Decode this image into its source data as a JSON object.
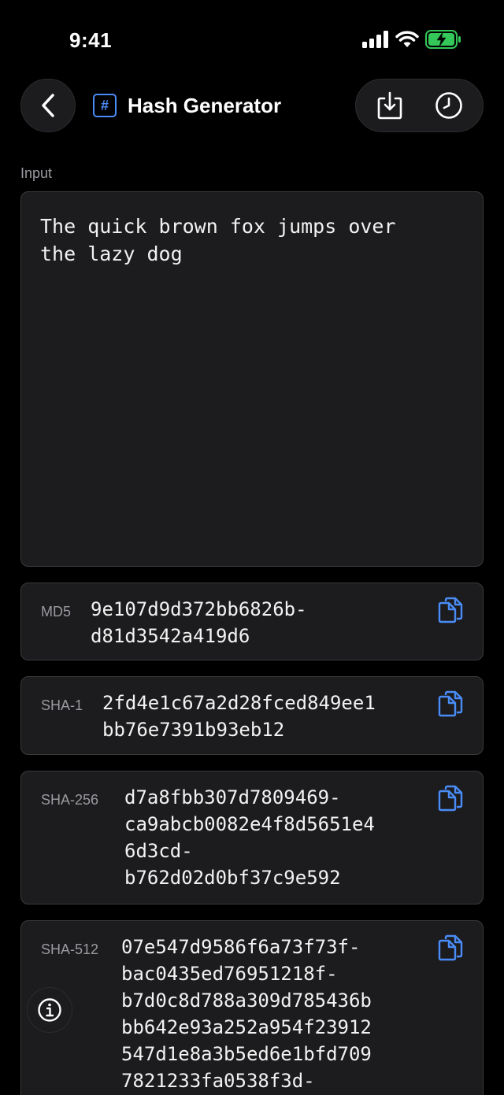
{
  "status_bar": {
    "time": "9:41"
  },
  "header": {
    "title": "Hash Generator",
    "title_icon": "hash-icon",
    "title_icon_glyph": "#"
  },
  "input": {
    "label": "Input",
    "value": "The quick brown fox jumps over\nthe lazy dog"
  },
  "hashes": [
    {
      "label": "MD5",
      "value": "9e107d9d372bb6826b-\nd81d3542a419d6"
    },
    {
      "label": "SHA-1",
      "value": "2fd4e1c67a2d28fced849ee1\nbb76e7391b93eb12"
    },
    {
      "label": "SHA-256",
      "value": "d7a8fbb307d7809469-\nca9abcb0082e4f8d5651e4\n6d3cd-\nb762d02d0bf37c9e592"
    },
    {
      "label": "SHA-512",
      "value": "07e547d9586f6a73f73f-\nbac0435ed76951218f-\nb7d0c8d788a309d785436b\nbb642e93a252a954f23912\n547d1e8a3b5ed6e1bfd709\n7821233fa0538f3d-"
    }
  ],
  "colors": {
    "accent": "#4a8cf7",
    "background": "#000000",
    "card": "#1c1c1e",
    "battery": "#34c759"
  }
}
